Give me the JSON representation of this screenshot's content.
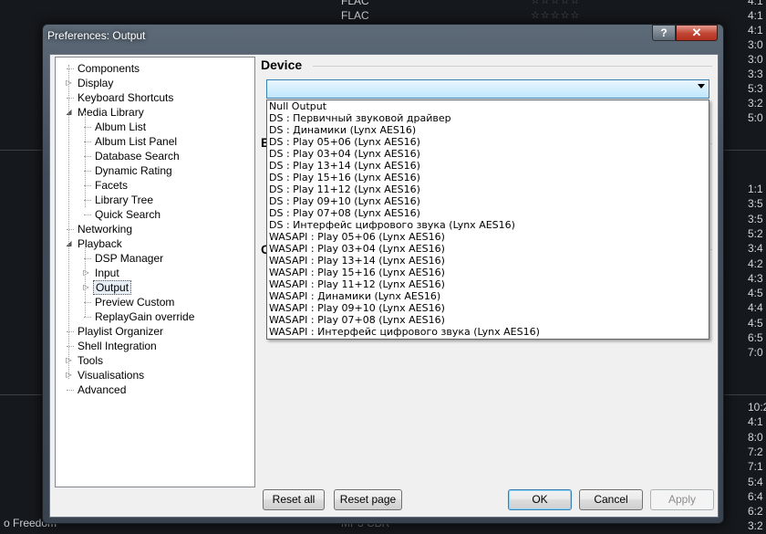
{
  "background": {
    "rows": [
      {
        "fmt": "FLAC",
        "time": "4:1"
      },
      {
        "fmt": "FLAC",
        "time": "4:1"
      },
      {
        "fmt": "",
        "time": "4:1"
      },
      {
        "fmt": "",
        "time": "3:0"
      },
      {
        "fmt": "",
        "time": "3:0"
      },
      {
        "fmt": "",
        "time": "3:3"
      },
      {
        "fmt": "",
        "time": "5:3"
      },
      {
        "fmt": "",
        "time": "3:2"
      },
      {
        "fmt": "",
        "time": "5:0"
      }
    ],
    "rows2": [
      "1:1",
      "3:5",
      "3:5",
      "5:2",
      "3:4",
      "4:2",
      "4:3",
      "4:5",
      "4:4",
      "4:5",
      "6:5",
      "7:0"
    ],
    "rows3": [
      "10:2",
      "4:1",
      "8:0",
      "7:2",
      "7:1",
      "5:4",
      "6:4",
      "6:2",
      "3:2"
    ],
    "stars": "☆☆☆☆☆",
    "track_title": "o Freedom",
    "track_format": "MP3 CBR"
  },
  "dialog": {
    "title": "Preferences: Output",
    "help_label": "?",
    "close_label": "✕"
  },
  "tree": [
    {
      "label": "Components",
      "twisty": ""
    },
    {
      "label": "Display",
      "twisty": "▷"
    },
    {
      "label": "Keyboard Shortcuts",
      "twisty": ""
    },
    {
      "label": "Media Library",
      "twisty": "◢"
    },
    {
      "label": "Album List",
      "twisty": ""
    },
    {
      "label": "Album List Panel",
      "twisty": ""
    },
    {
      "label": "Database Search",
      "twisty": ""
    },
    {
      "label": "Dynamic Rating",
      "twisty": ""
    },
    {
      "label": "Facets",
      "twisty": ""
    },
    {
      "label": "Library Tree",
      "twisty": ""
    },
    {
      "label": "Quick Search",
      "twisty": ""
    },
    {
      "label": "Networking",
      "twisty": ""
    },
    {
      "label": "Playback",
      "twisty": "◢"
    },
    {
      "label": "DSP Manager",
      "twisty": ""
    },
    {
      "label": "Input",
      "twisty": "▷"
    },
    {
      "label": "Output",
      "twisty": "▷"
    },
    {
      "label": "Preview Custom",
      "twisty": ""
    },
    {
      "label": "ReplayGain override",
      "twisty": ""
    },
    {
      "label": "Playlist Organizer",
      "twisty": ""
    },
    {
      "label": "Shell Integration",
      "twisty": ""
    },
    {
      "label": "Tools",
      "twisty": "▷"
    },
    {
      "label": "Visualisations",
      "twisty": "▷"
    },
    {
      "label": "Advanced",
      "twisty": ""
    }
  ],
  "device": {
    "section_title": "Device",
    "selected_value": "",
    "options": [
      "Null Output",
      "DS : Первичный звуковой драйвер",
      "DS : Динамики (Lynx AES16)",
      "DS : Play 05+06 (Lynx AES16)",
      "DS : Play 03+04 (Lynx AES16)",
      "DS : Play 13+14 (Lynx AES16)",
      "DS : Play 15+16 (Lynx AES16)",
      "DS : Play 11+12 (Lynx AES16)",
      "DS : Play 09+10 (Lynx AES16)",
      "DS : Play 07+08 (Lynx AES16)",
      "DS : Интерфейс цифрового звука (Lynx AES16)",
      "WASAPI : Play 05+06 (Lynx AES16)",
      "WASAPI : Play 03+04 (Lynx AES16)",
      "WASAPI : Play 13+14 (Lynx AES16)",
      "WASAPI : Play 15+16 (Lynx AES16)",
      "WASAPI : Play 11+12 (Lynx AES16)",
      "WASAPI : Динамики (Lynx AES16)",
      "WASAPI : Play 09+10 (Lynx AES16)",
      "WASAPI : Play 07+08 (Lynx AES16)",
      "WASAPI : Интерфейс цифрового звука (Lynx AES16)"
    ]
  },
  "partial_sections": {
    "first": "B",
    "second": "O"
  },
  "buttons": {
    "reset_all": "Reset all",
    "reset_page": "Reset page",
    "ok": "OK",
    "cancel": "Cancel",
    "apply": "Apply"
  }
}
